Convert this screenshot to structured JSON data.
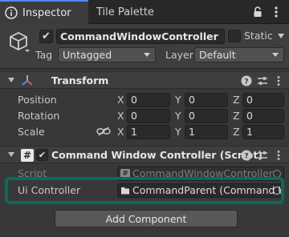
{
  "tabs": [
    {
      "label": "Inspector",
      "icon": "info-icon",
      "active": true
    },
    {
      "label": "Tile Palette",
      "active": false
    }
  ],
  "gameobject": {
    "active": true,
    "name": "CommandWindowController",
    "static_label": "Static",
    "static": false,
    "tag_label": "Tag",
    "tag_value": "Untagged",
    "layer_label": "Layer",
    "layer_value": "Default"
  },
  "transform": {
    "title": "Transform",
    "position": {
      "label": "Position",
      "x": "0",
      "y": "0",
      "z": "0"
    },
    "rotation": {
      "label": "Rotation",
      "x": "0",
      "y": "0",
      "z": "0"
    },
    "scale": {
      "label": "Scale",
      "x": "1",
      "y": "1",
      "z": "1"
    },
    "axis_x": "X",
    "axis_y": "Y",
    "axis_z": "Z"
  },
  "script_component": {
    "title": "Command Window Controller (Script)",
    "enabled": true,
    "script_label": "Script",
    "script_value": "CommandWindowController",
    "ui_controller_label": "Ui Controller",
    "ui_controller_value": "CommandParent (Command UI"
  },
  "add_component_label": "Add Component",
  "colors": {
    "accent": "#4c8dff",
    "highlight": "#0a6b5b"
  }
}
